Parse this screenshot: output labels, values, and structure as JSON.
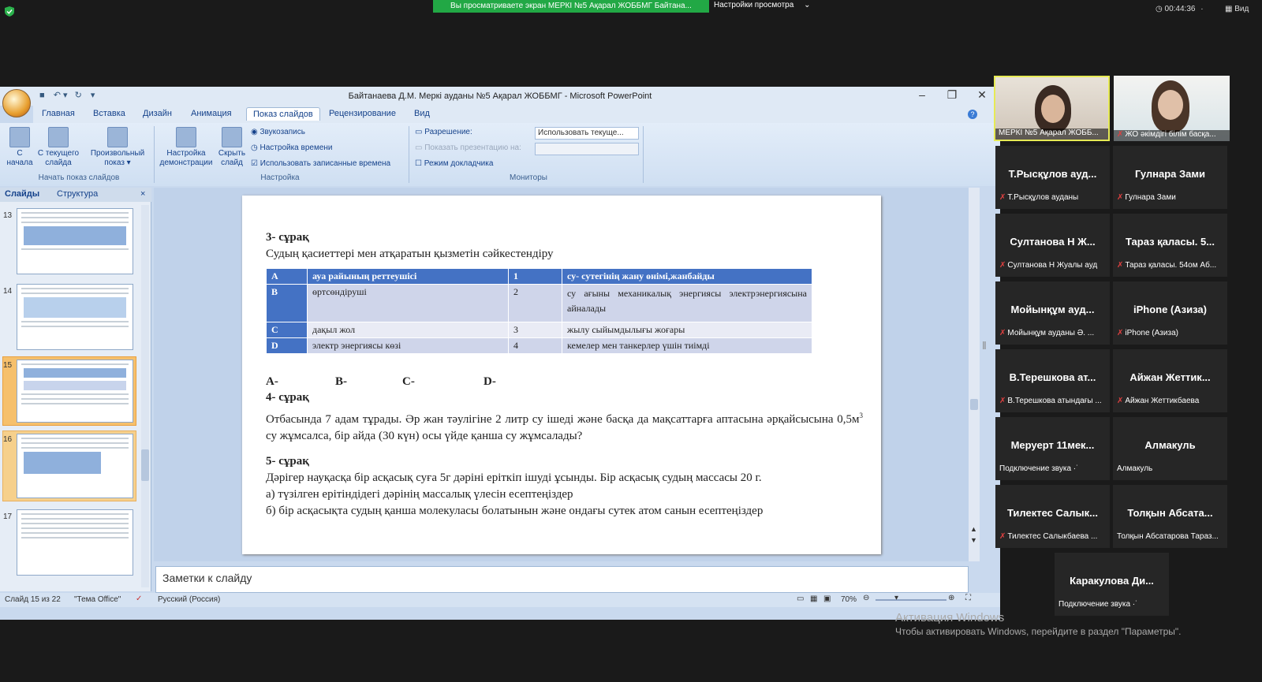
{
  "zoom": {
    "share_banner": "Вы просматриваете экран МЕРКІ №5 Ақарал ЖОББМГ Байтана...",
    "view_settings": "Настройки просмотра",
    "timer": "00:44:36",
    "view_label": "Вид"
  },
  "ppt": {
    "title": "Байтанаева Д.М. Меркі ауданы №5 Ақарал ЖОББМГ - Microsoft PowerPoint",
    "tabs": [
      "Главная",
      "Вставка",
      "Дизайн",
      "Анимация",
      "Показ слайдов",
      "Рецензирование",
      "Вид"
    ],
    "ribbon": {
      "btn_start_l1": "С",
      "btn_start_l2": "начала",
      "btn_current_l1": "С текущего",
      "btn_current_l2": "слайда",
      "btn_custom_l1": "Произвольный",
      "btn_custom_l2": "показ ▾",
      "group_start": "Начать показ слайдов",
      "btn_setup_l1": "Настройка",
      "btn_setup_l2": "демонстрации",
      "btn_hide_l1": "Скрыть",
      "btn_hide_l2": "слайд",
      "record": "Звукозапись",
      "timing": "Настройка времени",
      "use_timings": "Использовать записанные времена",
      "group_setup": "Настройка",
      "resolution_label": "Разрешение:",
      "resolution_value": "Использовать текуще...",
      "show_on_label": "Показать презентацию на:",
      "presenter_view": "Режим докладчика",
      "group_monitors": "Мониторы"
    },
    "pane_tabs": [
      "Слайды",
      "Структура"
    ],
    "thumb_numbers": [
      "13",
      "14",
      "15",
      "16",
      "17"
    ],
    "notes_placeholder": "Заметки к слайду",
    "status": {
      "slide": "Слайд 15 из 22",
      "theme": "\"Тема Office\"",
      "language": "Русский (Россия)",
      "zoom": "70%"
    }
  },
  "slide": {
    "q3_title": "3- сұрақ",
    "q3_text": "Судың қасиеттері мен атқаратын қызметін сәйкестендіру",
    "table": [
      [
        "A",
        "ауа райының реттеушісі",
        "1",
        "су- сутегінің жану өнімі,жанбайды"
      ],
      [
        "B",
        "өртсөндіруші",
        "2",
        "су ағыны механикалық энергиясы электрэнергиясына айналады"
      ],
      [
        "C",
        "дақыл жол",
        "3",
        " жылу сыйымдылығы жоғары"
      ],
      [
        "D",
        "электр энергиясы көзі",
        "4",
        "кемелер мен танкерлер үшін тиімді"
      ]
    ],
    "answers": [
      "A-",
      "B-",
      "C-",
      "D-"
    ],
    "q4_title": "4- сұрақ",
    "q4_text_a": "Отбасында 7 адам тұрады. Әр жан тәулігіне 2 литр су ішеді және басқа да мақсаттарға аптасына әрқайсысына 0,5м",
    "q4_sup": "3",
    "q4_text_b": " су жұмсалса, бір айда  (30 күн) осы үйде қанша су жұмсалады?",
    "q5_title": "5- сұрақ",
    "q5_line1": "Дәрігер науқасқа бір асқасық суға 5г дәріні еріткіп ішуді ұсынды. Бір асқасық судың массасы  20 г.",
    "q5_line2": "а) түзілген ерітіндідегі  дәрінің массалық үлесін есептеңіздер",
    "q5_line3": "б) бір асқасықта  судың қанша молекуласы болатынын және ондағы сутек атом санын есептеңіздер"
  },
  "participants": {
    "video1_label": "МЕРКІ №5 Ақарал ЖОББ...",
    "video2_label": "ЖО әкімдігі білім басқа...",
    "tiles": [
      {
        "name": "Т.Рысқұлов ауд...",
        "sub": "Т.Рысқұлов ауданы",
        "muted": true
      },
      {
        "name": "Гулнара Зами",
        "sub": "Гулнара Зами",
        "muted": true
      },
      {
        "name": "Султанова Н Ж...",
        "sub": "Султанова Н Жуалы ауд",
        "muted": true
      },
      {
        "name": "Тараз қаласы. 5...",
        "sub": "Тараз қаласы. 54ом Аб...",
        "muted": true
      },
      {
        "name": "Мойынқұм ауд...",
        "sub": "Мойынқұм ауданы Ә. ...",
        "muted": true
      },
      {
        "name": "iPhone (Азиза)",
        "sub": "iPhone (Азиза)",
        "muted": true
      },
      {
        "name": "В.Терешкова ат...",
        "sub": "В.Терешкова атындағы ...",
        "muted": true
      },
      {
        "name": "Айжан Жеттик...",
        "sub": "Айжан Жеттикбаева",
        "muted": true
      },
      {
        "name": "Меруерт 11мек...",
        "sub": "Подключение звука ·˙",
        "muted": false
      },
      {
        "name": "Алмакуль",
        "sub": "Алмакуль",
        "muted": false
      },
      {
        "name": "Тилектес Салык...",
        "sub": "Тилектес Салыкбаева ...",
        "muted": true
      },
      {
        "name": "Толқын Абсата...",
        "sub": "Толқын Абсатарова Тараз...",
        "muted": false
      },
      {
        "name": "Каракулова Ди...",
        "sub": "Подключение звука ·˙",
        "muted": false
      }
    ]
  },
  "windows_activation": {
    "title": "Активация Windows",
    "text": "Чтобы активировать Windows, перейдите в раздел \"Параметры\"."
  }
}
